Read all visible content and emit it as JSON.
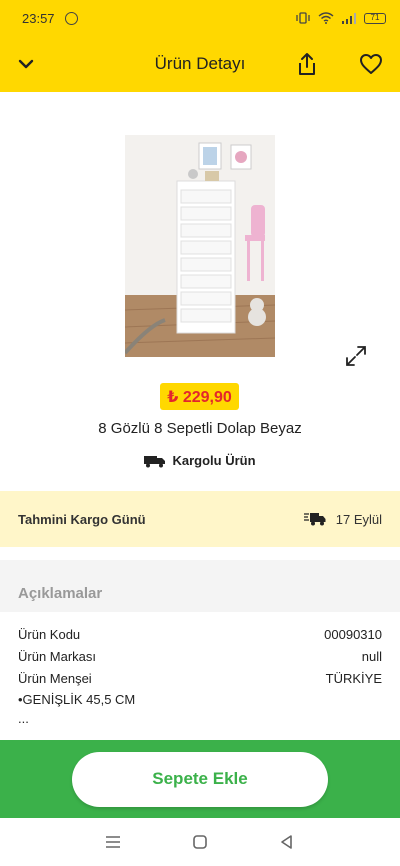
{
  "status_bar": {
    "time": "23:57",
    "battery": "71"
  },
  "header": {
    "title": "Ürün Detayı",
    "icons": {
      "back": "chevron-down-icon",
      "share": "share-icon",
      "favorite": "heart-icon"
    }
  },
  "product": {
    "price": "₺ 229,90",
    "name": "8 Gözlü 8 Sepetli Dolap Beyaz",
    "shipping_tag": "Kargolu Ürün"
  },
  "delivery": {
    "label": "Tahmini Kargo Günü",
    "date": "17 Eylül"
  },
  "description": {
    "title": "Açıklamalar",
    "specs": [
      {
        "label": "Ürün Kodu",
        "value": "00090310"
      },
      {
        "label": "Ürün Markası",
        "value": "null"
      },
      {
        "label": "Ürün Menşei",
        "value": "TÜRKİYE"
      }
    ],
    "extra_line": "•GENİŞLİK 45,5 CM",
    "ellipsis": "..."
  },
  "cta": {
    "add_to_cart": "Sepete Ekle"
  },
  "colors": {
    "brand_yellow": "#ffd800",
    "price_red": "#e3262c",
    "cta_green": "#3bb14a",
    "delivery_bg": "#fff6c9"
  }
}
